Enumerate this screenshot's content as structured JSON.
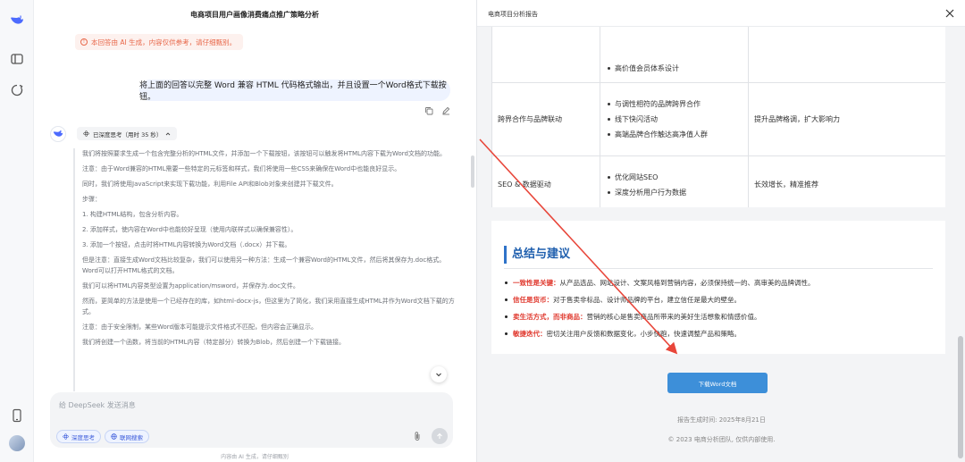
{
  "colors": {
    "accent": "#4d6bfe",
    "brand_blue": "#3d8fd9",
    "warning": "#e8684a",
    "highlight_red": "#e03a2f",
    "annotation": "#e8463a"
  },
  "rail": {
    "icons": [
      "whale-logo-icon",
      "sidebar-toggle-icon",
      "new-chat-icon",
      "phone-icon",
      "user-avatar"
    ]
  },
  "chat": {
    "title": "电商项目用户画像消费痛点推广策略分析",
    "warning": "本回答由 AI 生成，内容仅供参考，请仔细甄别。",
    "user_message": "将上面的回答以完整 Word 兼容 HTML 代码格式输出，并且设置一个Word格式下载按钮。",
    "think_label": "已深度思考（用时 35 秒）",
    "thought_paragraphs": [
      "我们将按照要求生成一个包含完整分析的HTML文件，并添加一个下载按钮，该按钮可以触发将HTML内容下载为Word文档的功能。",
      "注意：由于Word兼容的HTML需要一些特定的元标签和样式，我们将使用一些CSS来确保在Word中也能良好显示。",
      "同时，我们将使用JavaScript来实现下载功能，利用File API和Blob对象来创建并下载文件。",
      "步骤：",
      "1. 构建HTML结构，包含分析内容。",
      "2. 添加样式，使内容在Word中也能较好呈现（使用内联样式以确保兼容性）。",
      "3. 添加一个按钮，点击时将HTML内容转换为Word文档（.docx）并下载。",
      "但是注意：直接生成Word文档比较复杂，我们可以使用另一种方法：生成一个兼容Word的HTML文件，然后将其保存为.doc格式。Word可以打开HTML格式的文档。",
      "我们可以将HTML内容类型设置为application/msword，并保存为.doc文件。",
      "然而，更简单的方法是使用一个已经存在的库，如html-docx-js，但这里为了简化，我们采用直接生成HTML并作为Word文档下载的方式。",
      "注意：由于安全限制，某些Word版本可能提示文件格式不匹配，但内容会正确显示。",
      "我们将创建一个函数，将当前的HTML内容（特定部分）转换为Blob，然后创建一个下载链接。"
    ],
    "composer_placeholder": "给 DeepSeek 发送消息",
    "deep_think_label": "深度思考",
    "web_search_label": "联网搜索",
    "footnote": "内容由 AI 生成，请仔细甄别"
  },
  "panel": {
    "title": "电商项目分析报告",
    "table_rows": [
      {
        "strategy": "",
        "actions": [
          "高价值会员体系设计"
        ],
        "goal": ""
      },
      {
        "strategy": "跨界合作与品牌联动",
        "actions": [
          "与调性相符的品牌跨界合作",
          "线下快闪活动",
          "高端品牌合作触达高净值人群"
        ],
        "goal": "提升品牌格调，扩大影响力"
      },
      {
        "strategy": "SEO & 数据驱动",
        "actions": [
          "优化网站SEO",
          "深度分析用户行为数据"
        ],
        "goal": "长效增长，精准推荐"
      }
    ],
    "summary_title": "总结与建议",
    "summary_items": [
      {
        "key": "一致性是关键：",
        "text": "从产品选品、网站设计、文案风格到营销内容，必须保持统一的、高审美的品牌调性。"
      },
      {
        "key": "信任是货币：",
        "text": "对于售卖非标品、设计师品牌的平台，建立信任是最大的壁垒。"
      },
      {
        "key": "卖生活方式，而非商品：",
        "text": "营销的核心是售卖商品所带来的美好生活想象和情感价值。"
      },
      {
        "key": "敏捷迭代：",
        "text": "密切关注用户反馈和数据变化，小步快跑，快速调整产品和策略。"
      }
    ],
    "download_button": "下载Word文档",
    "generated_date": "报告生成时间: 2025年8月21日",
    "copyright": "© 2023 电商分析团队, 仅供内部使用."
  }
}
